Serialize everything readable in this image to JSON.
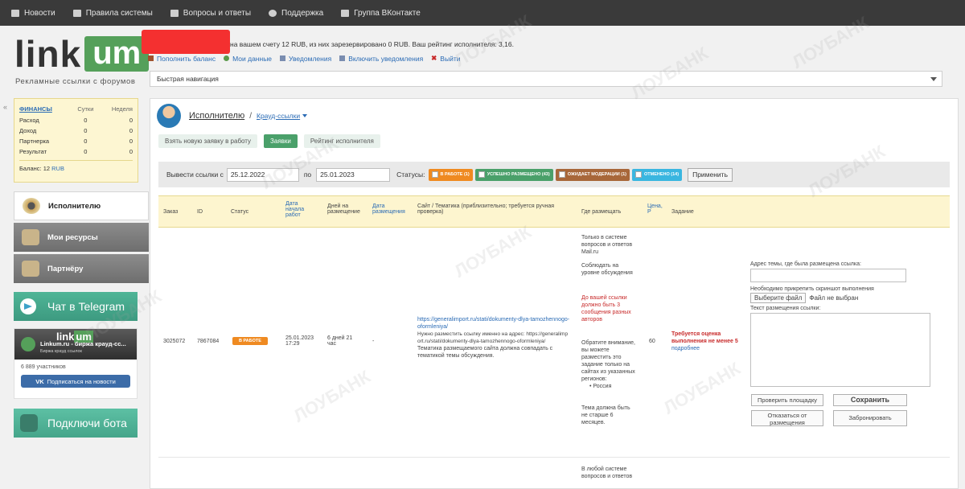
{
  "topbar": {
    "items": [
      {
        "label": "Новости",
        "icon": "news-icon"
      },
      {
        "label": "Правила системы",
        "icon": "document-icon"
      },
      {
        "label": "Вопросы и ответы",
        "icon": "questions-icon"
      },
      {
        "label": "Поддержка",
        "icon": "support-icon"
      },
      {
        "label": "Группа ВКонтакте",
        "icon": "group-icon"
      }
    ]
  },
  "header": {
    "logo_left": "link",
    "logo_right": "um",
    "tagline": "Рекламные ссылки с форумов",
    "account_text": "на вашем счету 12 RUB, из них зарезервировано 0 RUB. Ваш рейтинг исполнителя: 3,16.",
    "links": [
      "Пополнить баланс",
      "Мои данные",
      "Уведомления",
      "Включить уведомления",
      "Выйти"
    ],
    "quick_nav": "Быстрая навигация"
  },
  "finance": {
    "headers": [
      "ФИНАНСЫ",
      "Сутки",
      "Неделя"
    ],
    "rows": [
      {
        "label": "Расход",
        "day": "0",
        "week": "0"
      },
      {
        "label": "Доход",
        "day": "0",
        "week": "0"
      },
      {
        "label": "Партнерка",
        "day": "0",
        "week": "0"
      },
      {
        "label": "Результат",
        "day": "0",
        "week": "0"
      }
    ],
    "balance_label": "Баланс: 12",
    "balance_unit": "RUB"
  },
  "sidebar": {
    "items": [
      "Исполнителю",
      "Мои ресурсы",
      "Партнёру"
    ],
    "telegram": "Чат в Telegram",
    "vk_logo": "link",
    "vk_logo2": "um",
    "vk_name": "Linkum.ru - биржа крауд-сс...",
    "vk_sub": "Биржа крауд ссылок",
    "vk_members": "6 889 участников",
    "vk_button": "Подписаться на новости",
    "bot": "Подключи бота"
  },
  "main": {
    "title": "Исполнителю",
    "subtitle": "Крауд-ссылки",
    "tabs": [
      "Взять новую заявку в работу",
      "Заявки",
      "Рейтинг исполнителя"
    ],
    "filter": {
      "label": "Вывести ссылки с",
      "from": "25.12.2022",
      "to_label": "по",
      "to": "25.01.2023",
      "statuses_label": "Статусы:",
      "statuses": [
        {
          "label": "В РАБОТЕ (1)",
          "color": "#ef8a21"
        },
        {
          "label": "УСПЕШНО РАЗМЕЩЕНО (43)",
          "color": "#4aa06a"
        },
        {
          "label": "ОЖИДАЕТ МОДЕРАЦИИ (1)",
          "color": "#a8673a"
        },
        {
          "label": "ОТМЕНЕНО (14)",
          "color": "#3ab6e0"
        }
      ],
      "apply": "Применить"
    },
    "columns": [
      "Заказ",
      "ID",
      "Статус",
      "Дата начала работ",
      "Дней на размещение",
      "Дата размещения",
      "Сайт / Тематика (приблизительно; требуется ручная проверка)",
      "Где размещать",
      "Цена, Р",
      "Задание"
    ],
    "row": {
      "order": "3025072",
      "id": "7867084",
      "status": "В РАБОТЕ",
      "start": "25.01.2023 17:29",
      "days": "6 дней 21 час",
      "placed": "-",
      "site_link": "https://generalimport.ru/stati/dokumenty-dlya-tamozhennogo-oformleniya/",
      "site_note": "Нужно разместить ссылку именно на адрес: https://generalimport.ru/stati/dokumenty-dlya-tamozhennogo-oformleniya/",
      "site_theme": "Тематика размещаемого сайта должна совпадать с тематикой темы обсуждения.",
      "where_1": "Только в системе вопросов и ответов Mail.ru",
      "where_2": "Соблюдать на уровне обсуждения",
      "where_3": "До вашей ссылки должно быть 3 сообщения разных авторов",
      "where_4": "Обратите внимание, вы можете разместить это задание только на сайтах из указанных регионов:",
      "where_region": "Россия",
      "where_5": "Тема должна быть не старше 6 месяцев.",
      "price": "60",
      "task_red": "Требуется оценка выполнения не менее 5",
      "task_more": "подробнее",
      "form_url_label": "Адрес темы, где была размещена ссылка:",
      "form_screenshot_label": "Необходимо прикрепить скриншот выполнения",
      "file_button": "Выберите файл",
      "file_none": "Файл не выбран",
      "form_text_label": "Текст размещения ссылки:",
      "check_button": "Проверить площадку",
      "save_button": "Сохранить",
      "refuse_button": "Отказаться от размещения",
      "book_button": "Забронировать"
    },
    "next_row_where": "В любой системе вопросов и ответов"
  },
  "watermark": "ЛОУБАНК"
}
